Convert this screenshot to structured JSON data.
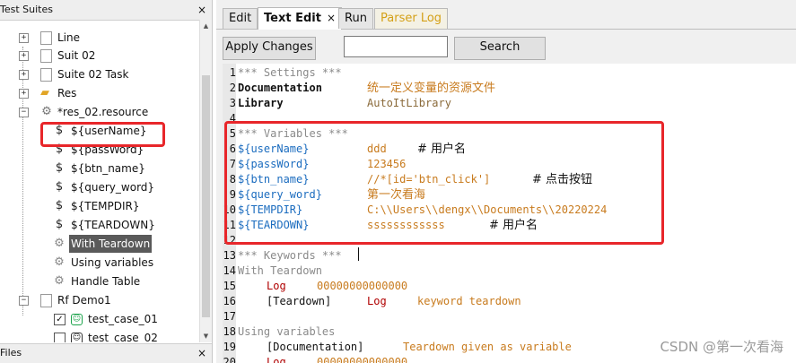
{
  "left_panel": {
    "suites_header": "Test Suites",
    "files_header": "Files",
    "close_glyph": "×",
    "tree": [
      {
        "label": "Line"
      },
      {
        "label": "Suit 02"
      },
      {
        "label": "Suite 02 Task"
      },
      {
        "label": "Res"
      },
      {
        "label": "*res_02.resource"
      },
      {
        "label": "${userName}"
      },
      {
        "label": "${passWord}"
      },
      {
        "label": "${btn_name}"
      },
      {
        "label": "${query_word}"
      },
      {
        "label": "${TEMPDIR}"
      },
      {
        "label": "${TEARDOWN}"
      },
      {
        "label": "With Teardown"
      },
      {
        "label": "Using variables"
      },
      {
        "label": "Handle Table"
      },
      {
        "label": "Rf Demo1"
      },
      {
        "label": "test_case_01"
      },
      {
        "label": "test_case_02"
      }
    ]
  },
  "tabs": [
    {
      "label": "Edit"
    },
    {
      "label": "Text Edit",
      "close": "×"
    },
    {
      "label": "Run"
    },
    {
      "label": "Parser Log"
    }
  ],
  "toolbar": {
    "apply_label": "Apply Changes",
    "search_value": "",
    "search_label": "Search"
  },
  "editor": {
    "line_numbers": [
      "1",
      "2",
      "3",
      "4",
      "5",
      "6",
      "7",
      "8",
      "9",
      "10",
      "11",
      "12",
      "13",
      "14",
      "15",
      "16",
      "17",
      "18",
      "19",
      "20"
    ],
    "settings_header": "*** Settings ***",
    "doc_setting": "Documentation",
    "doc_value": "统一定义变量的资源文件",
    "library_setting": "Library",
    "library_value": "AutoItLibrary",
    "variables_header": "*** Variables ***",
    "var_username": "${userName}",
    "val_username": "ddd",
    "cmt_username": "# 用户名",
    "var_password": "${passWord}",
    "val_password": "123456",
    "var_btn": "${btn_name}",
    "val_btn": "//*[id='btn_click']",
    "cmt_btn": "# 点击按钮",
    "var_query": "${query_word}",
    "val_query": "第一次看海",
    "var_tempdir": "${TEMPDIR}",
    "val_tempdir": "C:\\\\Users\\\\dengx\\\\Documents\\\\20220224",
    "var_teardown": "${TEARDOWN}",
    "val_teardown": "ssssssssssss",
    "cmt_teardown": "# 用户名",
    "keywords_header": "*** Keywords ***",
    "kw1_name": "With Teardown",
    "kw1_log": "Log",
    "kw1_log_val": "00000000000000",
    "kw1_teardown_setting": "[Teardown]",
    "kw1_teardown_log": "Log",
    "kw1_teardown_val": "keyword teardown",
    "kw2_name": "Using variables",
    "kw2_doc_setting": "[Documentation]",
    "kw2_doc_val": "Teardown given as variable",
    "kw2_log": "Log",
    "kw2_log_val": "00000000000000"
  },
  "watermark": "CSDN @第一次看海",
  "colors": {
    "highlight_box": "#e8262a",
    "section": "#8a8a8a",
    "variable": "#1b6cbf",
    "value": "#c87b1e",
    "keyword_call": "#b00000",
    "parser_log_tab": "#d4a017"
  }
}
